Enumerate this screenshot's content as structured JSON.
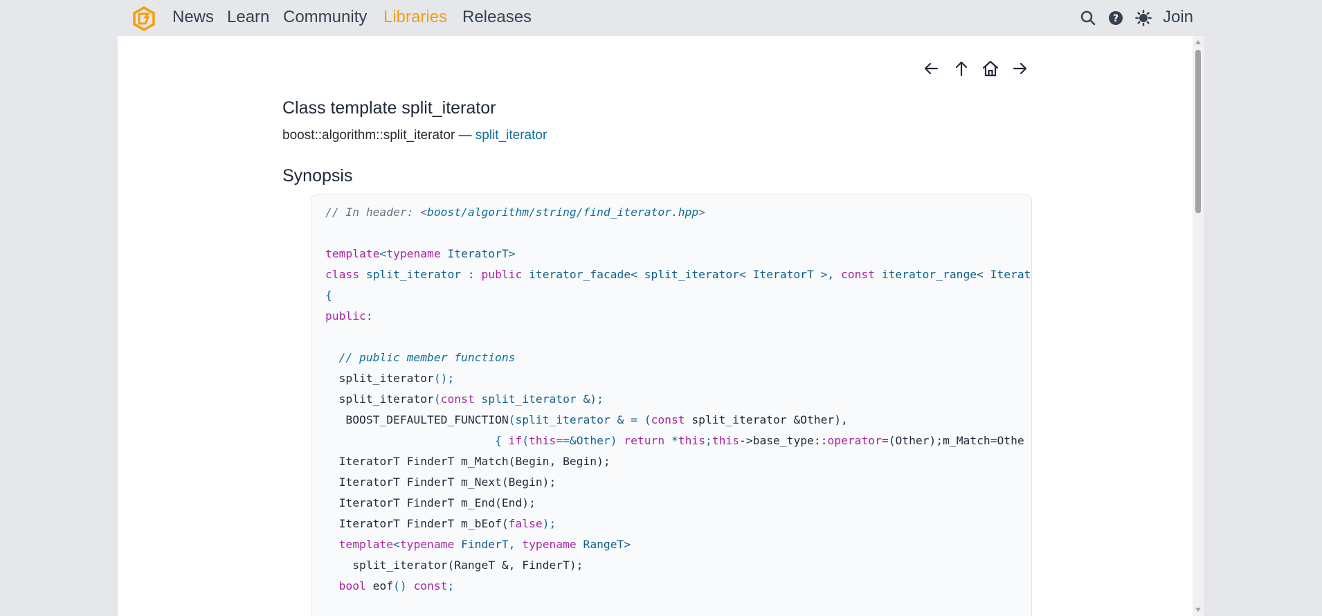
{
  "nav": {
    "items": [
      {
        "label": "News"
      },
      {
        "label": "Learn"
      },
      {
        "label": "Community"
      },
      {
        "label": "Libraries"
      },
      {
        "label": "Releases"
      }
    ],
    "active": "Libraries",
    "join_label": "Join",
    "icons": [
      "search-icon",
      "help-icon",
      "theme-toggle-icon"
    ]
  },
  "doc_nav": [
    "prev-arrow-icon",
    "up-arrow-icon",
    "home-icon",
    "next-arrow-icon"
  ],
  "page": {
    "title": "Class template split_iterator",
    "purpose_prefix": "boost::algorithm::split_iterator — ",
    "purpose_link": "split_iterator",
    "synopsis_heading": "Synopsis"
  },
  "code": {
    "header_comment": "// In header: <",
    "header_path": "boost/algorithm/string/find_iterator.hpp",
    "header_close": ">",
    "line_template1_a": "template",
    "line_template1_b": "<",
    "line_template1_c": "typename",
    "line_template1_d": " IteratorT>",
    "class_kw": "class",
    "class_name": " split_iterator : ",
    "public_kw": "public",
    "class_rest": " iterator_facade< split_iterator< IteratorT >, ",
    "const_kw": "const",
    "class_rest2": " iterator_range< Iterator",
    "open_brace": "{",
    "public_label": "public",
    "colon": ":",
    "comment_members": "// public member functions",
    "l_ctor1_name": "  split_iterator",
    "l_ctor1_tail": "();",
    "l_ctor2_name": "  split_iterator",
    "l_ctor2_open": "(",
    "l_ctor2_const": "const",
    "l_ctor2_rest": " split_iterator &);",
    "l_def_name": "   BOOST_DEFAULTED_FUNCTION",
    "l_def_open": "(",
    "l_def_a": "split_iterator & = (",
    "l_def_const": "const",
    "l_def_b": " split_iterator &Other),",
    "l_body_indent": "                         ",
    "l_body_a": "{ ",
    "l_body_if": "if",
    "l_body_b": "(",
    "l_body_this": "this",
    "l_body_c": "==&Other) ",
    "l_body_return": "return",
    "l_body_d": " *",
    "l_body_this2": "this",
    "l_body_e": ";",
    "l_body_this3": "this",
    "l_body_f": "->base_type::",
    "l_body_operator": "operator",
    "l_body_g": "=(Other);m_Match=Othe",
    "l_match": "  IteratorT FinderT m_Match(Begin, Begin);",
    "l_next": "  IteratorT FinderT m_Next(Begin);",
    "l_end": "  IteratorT FinderT m_End(End);",
    "l_beof_a": "  IteratorT FinderT m_bEof(",
    "l_beof_false": "false",
    "l_beof_b": ");",
    "l_tmpl2_a": "  template",
    "l_tmpl2_b": "<",
    "l_tmpl2_tn": "typename",
    "l_tmpl2_c": " FinderT, ",
    "l_tmpl2_tn2": "typename",
    "l_tmpl2_d": " RangeT>",
    "l_ctor3": "    split_iterator(RangeT &, FinderT);",
    "l_eof_bool": "  bool",
    "l_eof_a": " eof",
    "l_eof_b": "() ",
    "l_eof_const": "const",
    "l_eof_c": ";"
  }
}
